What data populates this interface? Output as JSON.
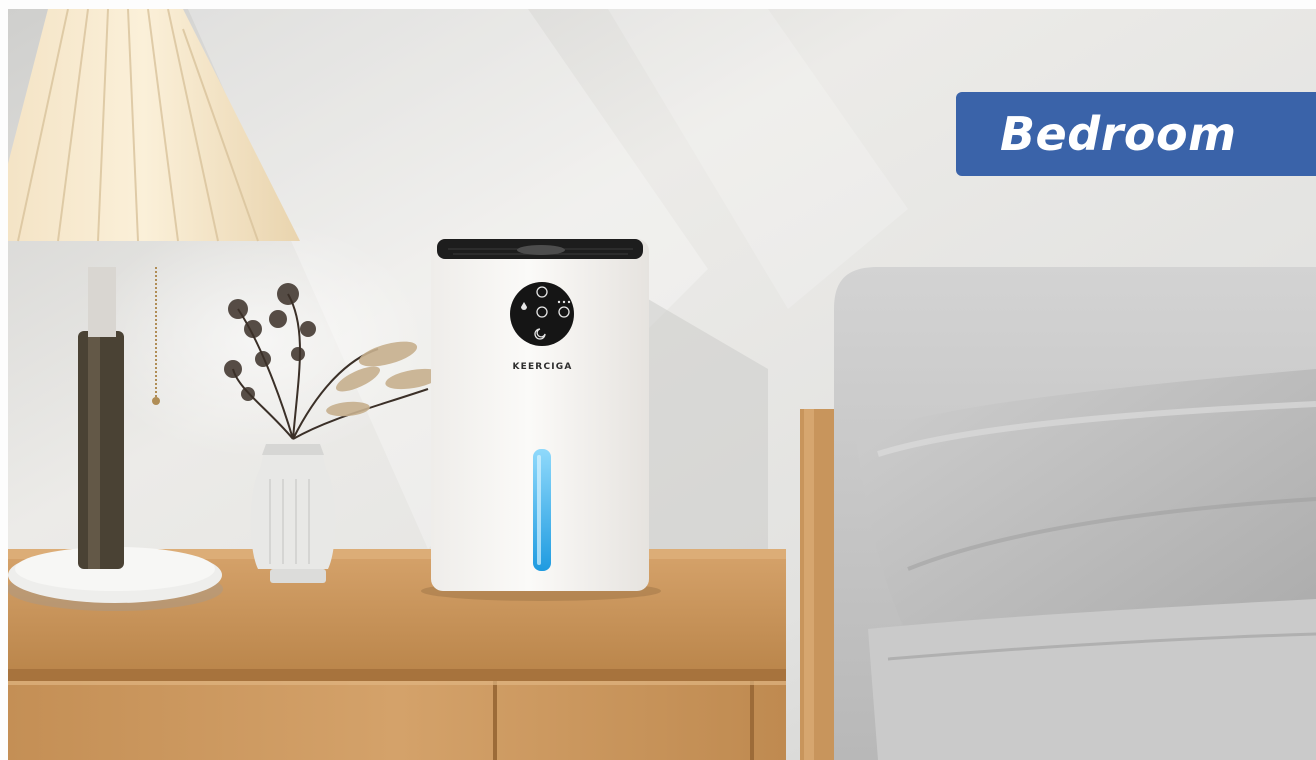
{
  "scene": {
    "room_label": "Bedroom",
    "product_brand": "KEERCIGA"
  },
  "colors": {
    "badge_bg": "#3a63a9",
    "badge_text": "#ffffff",
    "wall": "#e4e4e2",
    "wood": "#c8955c",
    "device_body": "#f7f5f2",
    "water_indicator": "#39b6ee",
    "bedding": "#bdbdbd"
  },
  "icons": [
    "power-icon",
    "fan-icon",
    "timer-icon",
    "sleep-icon",
    "drop-icon"
  ]
}
